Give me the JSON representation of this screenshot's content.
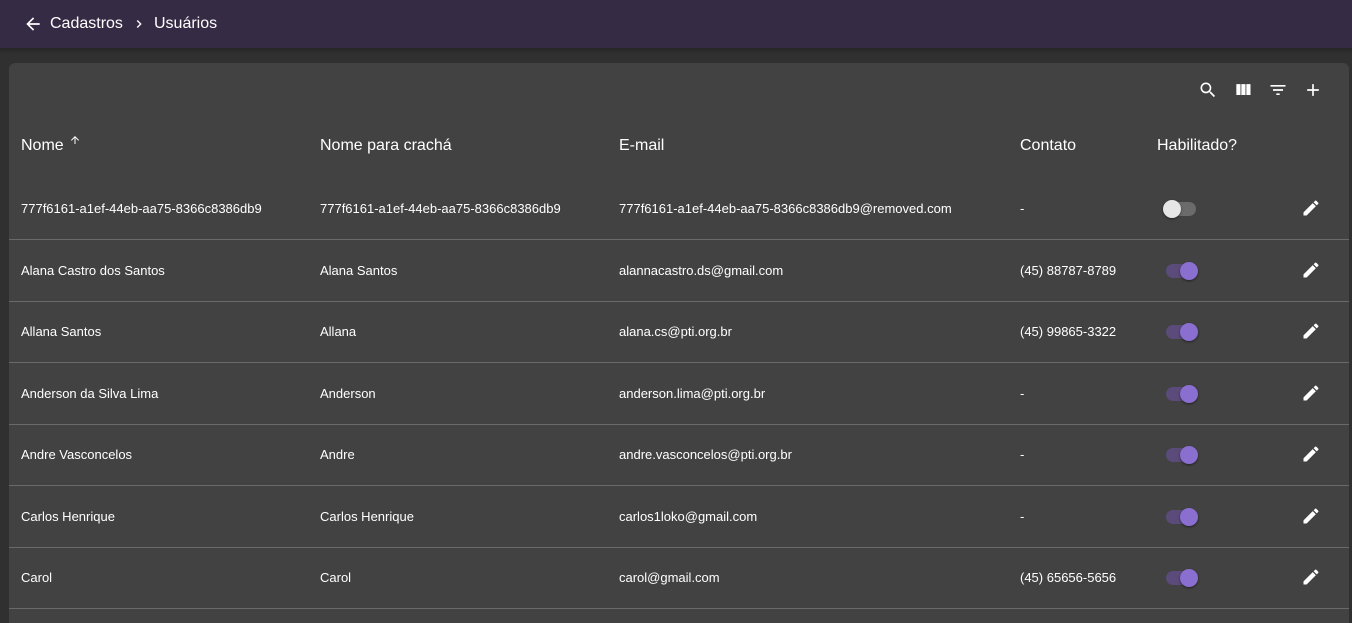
{
  "header": {
    "back_icon": "arrow-left-icon",
    "breadcrumb": [
      "Cadastros",
      "Usuários"
    ],
    "separator_icon": "chevron-right-icon",
    "background": "#352b45"
  },
  "toolbar": {
    "icons": [
      "search-icon",
      "view-column-icon",
      "filter-list-icon",
      "add-icon"
    ]
  },
  "table": {
    "columns": [
      "Nome",
      "Nome para crachá",
      "E-mail",
      "Contato",
      "Habilitado?"
    ],
    "sort": {
      "column": "Nome",
      "direction": "ascending",
      "icon": "arrow-up-icon"
    },
    "rows": [
      {
        "nome": "777f6161-a1ef-44eb-aa75-8366c8386db9",
        "cracha": "777f6161-a1ef-44eb-aa75-8366c8386db9",
        "email": "777f6161-a1ef-44eb-aa75-8366c8386db9@removed.com",
        "contato": "-",
        "habilitado": false
      },
      {
        "nome": "Alana Castro dos Santos",
        "cracha": "Alana Santos",
        "email": "alannacastro.ds@gmail.com",
        "contato": "(45) 88787-8789",
        "habilitado": true
      },
      {
        "nome": "Allana Santos",
        "cracha": "Allana",
        "email": "alana.cs@pti.org.br",
        "contato": "(45) 99865-3322",
        "habilitado": true
      },
      {
        "nome": "Anderson da Silva Lima",
        "cracha": "Anderson",
        "email": "anderson.lima@pti.org.br",
        "contato": "-",
        "habilitado": true
      },
      {
        "nome": "Andre Vasconcelos",
        "cracha": "Andre",
        "email": "andre.vasconcelos@pti.org.br",
        "contato": "-",
        "habilitado": true
      },
      {
        "nome": "Carlos Henrique",
        "cracha": "Carlos Henrique",
        "email": "carlos1loko@gmail.com",
        "contato": "-",
        "habilitado": true
      },
      {
        "nome": "Carol",
        "cracha": "Carol",
        "email": "carol@gmail.com",
        "contato": "(45) 65656-5656",
        "habilitado": true
      }
    ],
    "row_action_icon": "edit-pencil-icon"
  },
  "colors": {
    "accent": "#8a6fd0",
    "card": "#424242",
    "background": "#303030"
  }
}
